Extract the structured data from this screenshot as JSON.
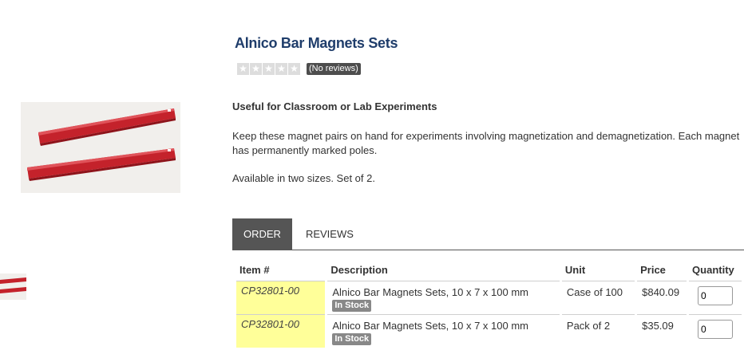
{
  "product": {
    "title": "Alnico Bar Magnets Sets",
    "rating_stars": 0,
    "reviews_badge": "(No reviews)",
    "subheading": "Useful for Classroom or Lab Experiments",
    "description": "Keep these magnet pairs on hand for experiments involving magnetization and demagnetization. Each magnet has permanently marked poles.",
    "availability": "Available in two sizes. Set of 2."
  },
  "tabs": [
    {
      "label": "ORDER",
      "active": true
    },
    {
      "label": "REVIEWS",
      "active": false
    }
  ],
  "table": {
    "headers": {
      "item": "Item #",
      "description": "Description",
      "unit": "Unit",
      "price": "Price",
      "quantity": "Quantity"
    },
    "rows": [
      {
        "item": "CP32801-00",
        "description": "Alnico Bar Magnets Sets, 10 x 7 x 100 mm",
        "stock": "In Stock",
        "unit": "Case of 100",
        "price": "$840.09",
        "quantity": "0"
      },
      {
        "item": "CP32801-00",
        "description": "Alnico Bar Magnets Sets, 10 x 7 x 100 mm",
        "stock": "In Stock",
        "unit": "Pack of 2",
        "price": "$35.09",
        "quantity": "0"
      }
    ]
  },
  "colors": {
    "title": "#1f3d6b",
    "item_highlight": "#ffff99",
    "tab_active": "#555555",
    "magnet_red": "#c4222b"
  }
}
